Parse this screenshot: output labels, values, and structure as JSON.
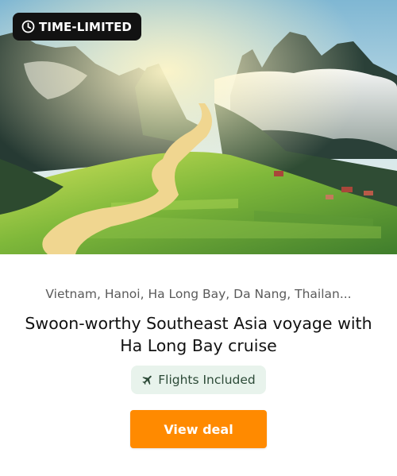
{
  "badge": {
    "label": "TIME-LIMITED",
    "icon": "clock-icon"
  },
  "hero": {
    "icon": "landscape-photo",
    "palette": {
      "sky": "#a9cfe0",
      "mist": "#eef1f0",
      "mountain": "#263a33",
      "field": "#7fb83a",
      "river": "#f0d690"
    }
  },
  "deal": {
    "destinations": "Vietnam, Hanoi, Ha Long Bay, Da Nang, Thailan...",
    "title": "Swoon-worthy Southeast Asia voyage with Ha Long Bay cruise",
    "inclusion": {
      "label": "Flights Included",
      "icon": "airplane-icon"
    },
    "cta_label": "View deal"
  },
  "colors": {
    "accent": "#ff8a00",
    "badge_bg": "#121212",
    "inclusion_bg": "#e8f3ec",
    "inclusion_text": "#2c4a37"
  }
}
